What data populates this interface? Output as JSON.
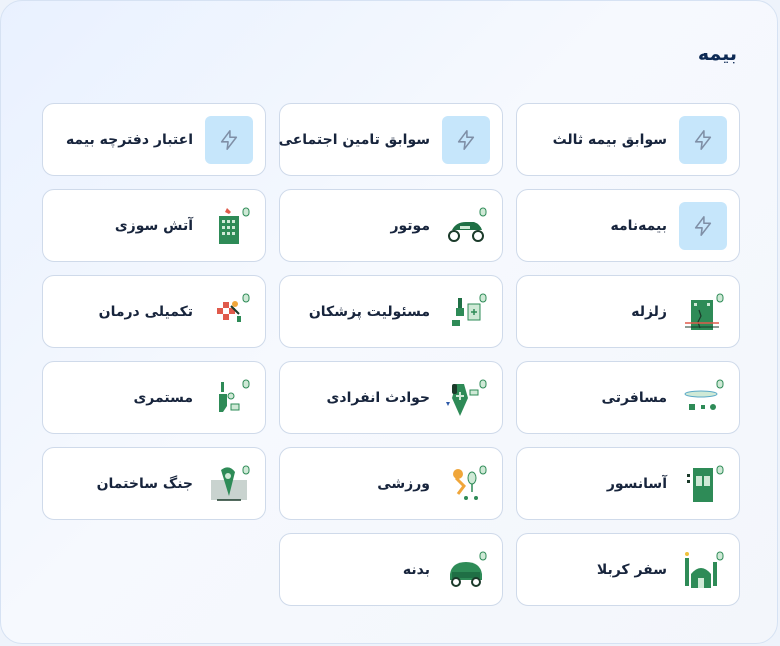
{
  "page": {
    "title": "بیمه"
  },
  "colors": {
    "accent_bg": "#c6e6fb",
    "icon_green": "#2e8b57",
    "title": "#0d2a55"
  },
  "services": [
    {
      "label": "سوابق بیمه ثالث",
      "icon": "lightning-icon"
    },
    {
      "label": "سوابق تامین اجتماعی",
      "icon": "lightning-icon"
    },
    {
      "label": "اعتبار دفترچه بیمه",
      "icon": "lightning-icon"
    },
    {
      "label": "بیمه‌نامه",
      "icon": "lightning-icon"
    },
    {
      "label": "موتور",
      "icon": "motorcycle-icon"
    },
    {
      "label": "آتش سوزی",
      "icon": "burning-building-icon"
    },
    {
      "label": "زلزله",
      "icon": "earthquake-building-icon"
    },
    {
      "label": "مسئولیت پزشکان",
      "icon": "medical-liability-icon"
    },
    {
      "label": "تکمیلی درمان",
      "icon": "medical-supplement-icon"
    },
    {
      "label": "مسافرتی",
      "icon": "travel-icon"
    },
    {
      "label": "حوادث انفرادی",
      "icon": "personal-accident-icon"
    },
    {
      "label": "مستمری",
      "icon": "pension-icon"
    },
    {
      "label": "آسانسور",
      "icon": "elevator-icon"
    },
    {
      "label": "ورزشی",
      "icon": "sports-icon"
    },
    {
      "label": "جنگ ساختمان",
      "icon": "building-war-icon"
    },
    {
      "label": "سفر کربلا",
      "icon": "mosque-icon"
    },
    {
      "label": "بدنه",
      "icon": "car-body-icon"
    }
  ]
}
